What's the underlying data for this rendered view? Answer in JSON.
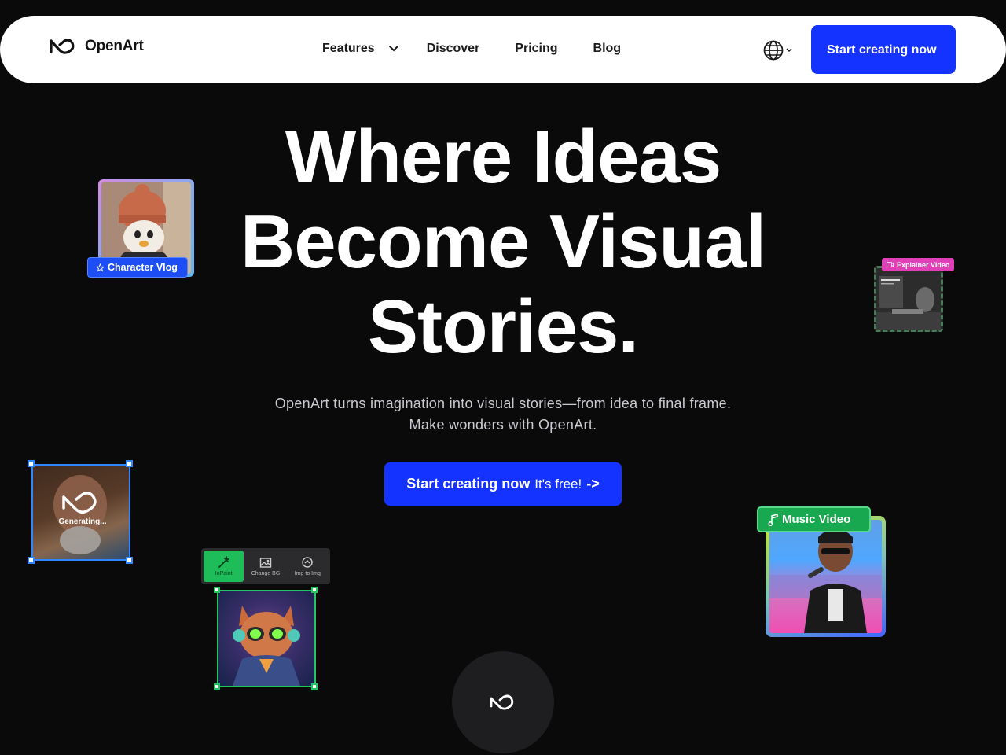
{
  "brand": {
    "name": "OpenArt",
    "accent": "#1533ff"
  },
  "nav": {
    "links": [
      "Features",
      "Discover",
      "Pricing",
      "Blog"
    ],
    "cta": "Start creating now"
  },
  "hero": {
    "title_lines": [
      "Where Ideas",
      "Become Visual",
      "Stories."
    ],
    "subtitle_lines": [
      "OpenArt turns imagination into visual stories—from idea to final frame.",
      "Make wonders with OpenArt."
    ],
    "cta_bold": "Start creating now",
    "cta_regular": "It's free!",
    "cta_arrow": "->"
  },
  "cards": {
    "character_vlog": "Character Vlog",
    "explainer_video": "Explainer Video",
    "generating": "Generating...",
    "music_video": "Music Video",
    "tools": [
      "InPaint",
      "Change BG",
      "Img to Img"
    ]
  },
  "icons": [
    "openart-logo-icon",
    "chevron-down-icon",
    "globe-icon",
    "star-icon",
    "music-note-icon",
    "video-icon",
    "inpaint-icon",
    "change-bg-icon",
    "img-to-img-icon",
    "infinity-icon"
  ]
}
